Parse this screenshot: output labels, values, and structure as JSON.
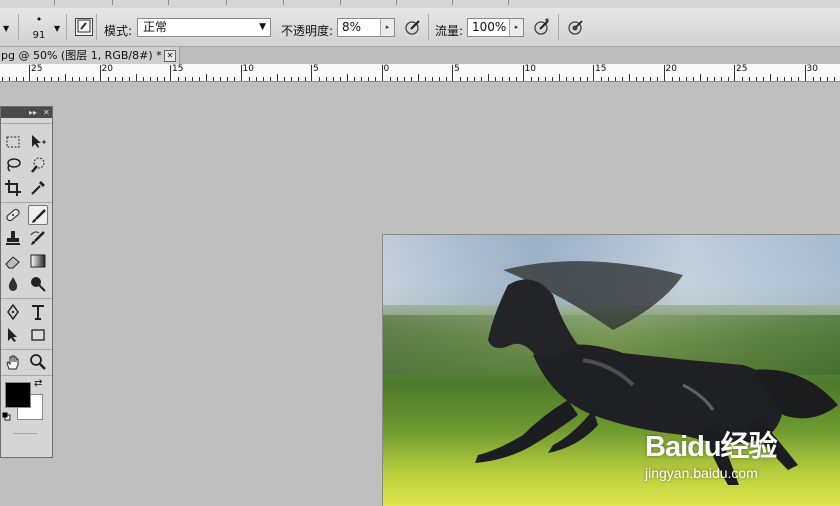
{
  "options_bar": {
    "brush_size": "91",
    "mode_label": "模式:",
    "mode_value": "正常",
    "opacity_label": "不透明度:",
    "opacity_value": "8%",
    "flow_label": "流量:",
    "flow_value": "100%"
  },
  "document": {
    "tab_title": "pg @ 50% (图层 1, RGB/8#) *"
  },
  "ruler": {
    "labels": [
      "25",
      "20",
      "15",
      "10",
      "5",
      "0",
      "5",
      "10",
      "15",
      "20",
      "25",
      "30"
    ]
  },
  "canvas": {
    "watermark_brand": "Baidu经验",
    "watermark_url": "jingyan.baidu.com"
  },
  "tools_panel": {
    "tools": [
      "rectangular-marquee",
      "move",
      "lasso",
      "quick-selection",
      "crop",
      "eyedropper",
      "healing-brush",
      "brush",
      "clone-stamp",
      "history-brush",
      "eraser",
      "gradient",
      "blur",
      "dodge",
      "pen",
      "type",
      "path-selection",
      "rectangle",
      "hand",
      "zoom"
    ],
    "active_tool": "brush",
    "foreground_color": "#000000",
    "background_color": "#ffffff"
  }
}
